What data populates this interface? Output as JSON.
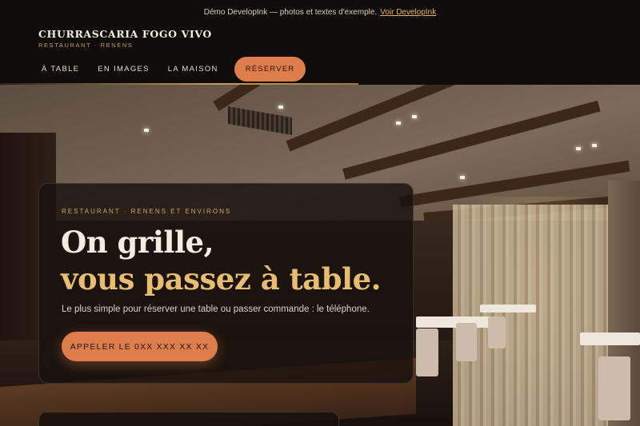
{
  "demo_banner": {
    "text": "Démo DevelopInk — photos et textes d'exemple.",
    "link_label": "Voir DevelopInk"
  },
  "brand": {
    "name": "CHURRASCARIA FOGO VIVO",
    "tagline": "RESTAURANT · RENENS"
  },
  "nav": {
    "items": [
      {
        "label": "À TABLE"
      },
      {
        "label": "EN IMAGES"
      },
      {
        "label": "LA MAISON"
      }
    ],
    "cta_label": "RÉSERVER"
  },
  "hero": {
    "eyebrow": "RESTAURANT · RENENS ET ENVIRONS",
    "headline_line1": "On grille,",
    "headline_line2": "vous passez à table.",
    "lede": "Le plus simple pour réserver une table ou passer commande : le téléphone.",
    "call_label": "APPELER LE 0XX XXX XX XX"
  },
  "colors": {
    "accent": "#de7e4c",
    "gold": "#e8bd72",
    "background": "#0f0c09"
  }
}
